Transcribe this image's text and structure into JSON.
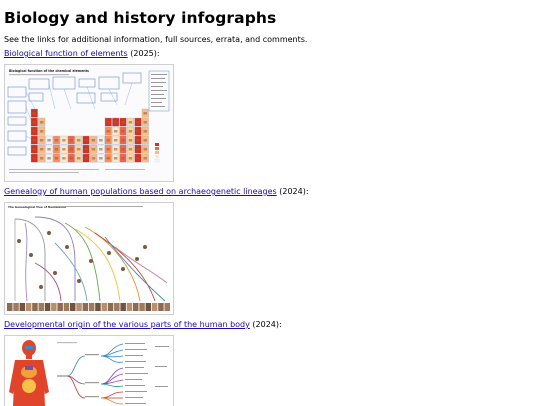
{
  "page": {
    "title": "Biology and history infographs",
    "intro": "See the links for additional information, full sources, errata, and comments."
  },
  "entries": [
    {
      "link_text": "Biological function of elements",
      "year_text": " (2025):",
      "thumb_title": "Biological function of the chemical elements"
    },
    {
      "link_text": "Genealogy of human populations based on archaeogenetic lineages",
      "year_text": " (2024):",
      "thumb_title": "The Genealogical Tree of Humankind"
    },
    {
      "link_text": "Developmental origin of the various parts of the human body",
      "year_text": " (2024):",
      "thumb_title": ""
    }
  ],
  "colors": {
    "link": "#1a0dab",
    "accent_red": "#d7301f",
    "accent_blue": "#3b6fc4",
    "accent_orange": "#f0a030"
  }
}
